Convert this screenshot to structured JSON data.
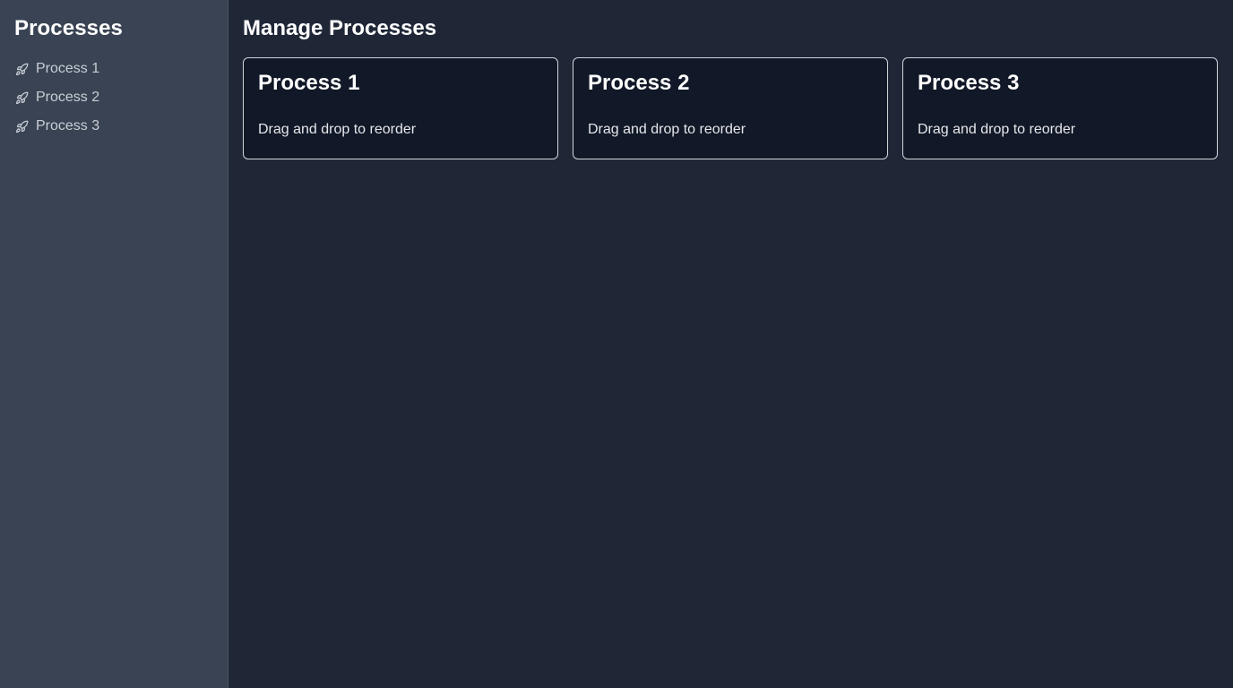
{
  "sidebar": {
    "title": "Processes",
    "items": [
      {
        "label": "Process 1",
        "icon": "rocket-icon"
      },
      {
        "label": "Process 2",
        "icon": "rocket-icon"
      },
      {
        "label": "Process 3",
        "icon": "rocket-icon"
      }
    ]
  },
  "main": {
    "title": "Manage Processes",
    "cards": [
      {
        "title": "Process 1",
        "hint": "Drag and drop to reorder"
      },
      {
        "title": "Process 2",
        "hint": "Drag and drop to reorder"
      },
      {
        "title": "Process 3",
        "hint": "Drag and drop to reorder"
      }
    ]
  },
  "colors": {
    "sidebar_bg": "#394353",
    "main_bg": "#1f2737",
    "card_bg": "#111827",
    "card_border": "#d1d5db",
    "text_primary": "#ffffff",
    "text_muted": "#c9ced6"
  }
}
